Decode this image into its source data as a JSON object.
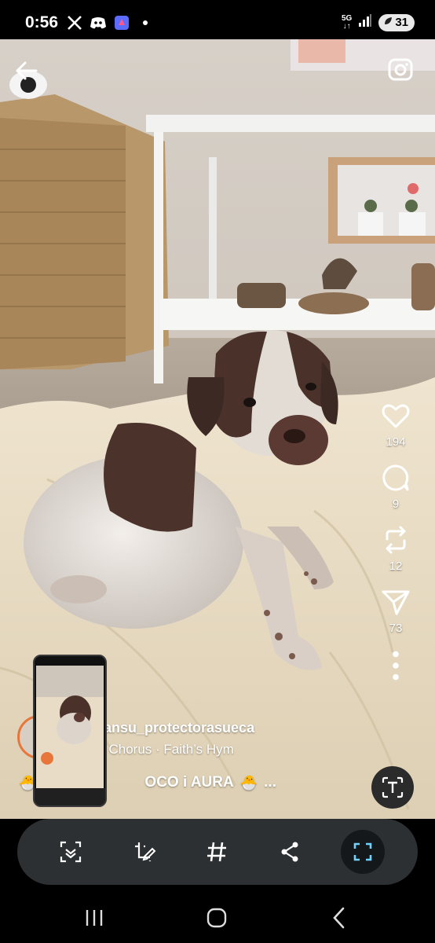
{
  "status_bar": {
    "time": "0:56",
    "network": "5G",
    "battery": "31",
    "icons": [
      "x-icon",
      "discord-icon",
      "app-icon",
      "dot-icon",
      "signal-icon"
    ]
  },
  "post": {
    "username": "ansu_protectorasueca",
    "music": "l Chorus · Faith’s Hym",
    "caption": "OCO i AURA",
    "caption_emoji_left": "🐣",
    "caption_emoji_right": "🐣",
    "caption_more": "...",
    "likes": "194",
    "comments": "9",
    "reposts": "12",
    "shares": "73"
  },
  "colors": {
    "toolbar": "#2c3032",
    "accent_scan": "#6fd3ff",
    "avatar_ring": "#e8763a"
  },
  "toolbar": {
    "tools": [
      "smart-select-icon",
      "edit-icon",
      "hashtag-icon",
      "share-icon",
      "scan-icon"
    ]
  },
  "nav": {
    "buttons": [
      "recents-icon",
      "home-icon",
      "back-icon"
    ]
  }
}
